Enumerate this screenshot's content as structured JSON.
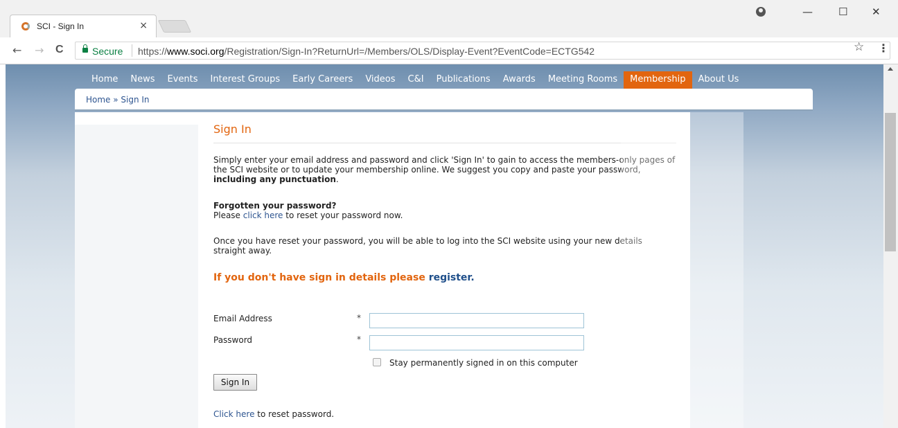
{
  "browser": {
    "tab_title": "SCI - Sign In",
    "tab_close": "×",
    "secure_label": "Secure",
    "url_prefix": "https://",
    "url_domain": "www.soci.org",
    "url_path": "/Registration/Sign-In?ReturnUrl=/Members/OLS/Display-Event?EventCode=ECTG542",
    "back": "←",
    "forward": "→",
    "reload": "C",
    "star": "☆",
    "menu": "⋮",
    "minimize": "—",
    "maximize": "☐",
    "close": "✕"
  },
  "nav": {
    "items": [
      {
        "label": "Home"
      },
      {
        "label": "News"
      },
      {
        "label": "Events"
      },
      {
        "label": "Interest Groups"
      },
      {
        "label": "Early Careers"
      },
      {
        "label": "Videos"
      },
      {
        "label": "C&I"
      },
      {
        "label": "Publications"
      },
      {
        "label": "Awards"
      },
      {
        "label": "Meeting Rooms"
      },
      {
        "label": "Membership"
      },
      {
        "label": "About Us"
      }
    ],
    "active": "Membership"
  },
  "breadcrumb": "Home » Sign In",
  "page": {
    "title": "Sign In",
    "intro_1": "Simply enter your email address and password and click 'Sign In' to gain to access the members-only pages of the SCI website or to update your membership online. We suggest you copy and paste your password, ",
    "intro_bold": "including any punctuation",
    "intro_end": ".",
    "forgot_heading": "Forgotten your password?",
    "forgot_pre": "Please ",
    "forgot_link": "click here",
    "forgot_post": " to reset your password now.",
    "reset_note": "Once you have reset your password, you will be able to log into the SCI website using your new details straight away.",
    "cta_text": "If you don't have sign in details please ",
    "cta_link": "register",
    "cta_end": "."
  },
  "form": {
    "email_label": "Email Address",
    "password_label": "Password",
    "required_mark": "*",
    "email_value": "",
    "password_value": "",
    "stay_signed_in": "Stay permanently signed in on this computer",
    "submit_label": "Sign In",
    "reset_link": "Click here",
    "reset_text": " to reset password."
  },
  "colors": {
    "accent": "#e2650f",
    "link": "#2e5590"
  }
}
